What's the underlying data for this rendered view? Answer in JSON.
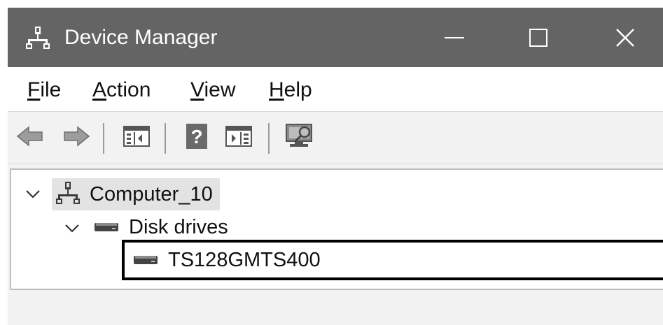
{
  "window": {
    "title": "Device Manager",
    "icons": {
      "app": "computer-network-icon",
      "minimize": "minimize-icon",
      "maximize": "maximize-icon",
      "close": "close-icon"
    },
    "colors": {
      "titlebar": "#646464",
      "selection_outline": "#000000",
      "tree_highlight": "#e3e3e3"
    }
  },
  "menu": {
    "items": [
      {
        "accel": "F",
        "rest": "ile"
      },
      {
        "accel": "A",
        "rest": "ction"
      },
      {
        "accel": "V",
        "rest": "iew"
      },
      {
        "accel": "H",
        "rest": "elp"
      }
    ]
  },
  "toolbar": {
    "buttons": [
      {
        "icon": "back-arrow-icon"
      },
      {
        "icon": "forward-arrow-icon"
      },
      {
        "icon": "show-hide-console-tree-icon"
      },
      {
        "icon": "help-icon",
        "glyph": "?"
      },
      {
        "icon": "show-action-pane-icon"
      },
      {
        "icon": "scan-hardware-changes-icon"
      }
    ]
  },
  "tree": {
    "root": {
      "label": "Computer_10",
      "expanded": true,
      "icon": "computer-network-icon",
      "children": [
        {
          "label": "Disk drives",
          "expanded": true,
          "icon": "disk-drive-icon",
          "children": [
            {
              "label": "TS128GMTS400",
              "icon": "disk-drive-icon",
              "selected": true
            }
          ]
        }
      ]
    }
  }
}
